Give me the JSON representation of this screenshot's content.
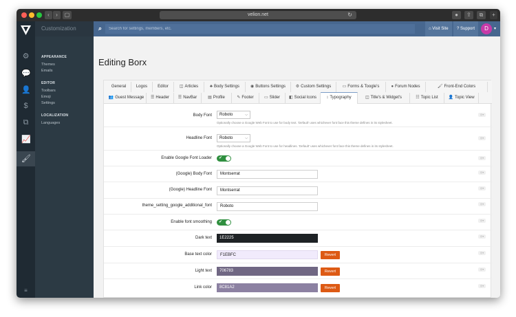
{
  "browser": {
    "url": "velion.net"
  },
  "sidebar": {
    "header": "Customization",
    "sections": [
      {
        "title": "APPEARANCE",
        "items": [
          "Themes",
          "Emails"
        ]
      },
      {
        "title": "EDITOR",
        "items": [
          "Toolbars",
          "Emoji",
          "Settings"
        ]
      },
      {
        "title": "LOCALIZATION",
        "items": [
          "Languages"
        ]
      }
    ],
    "rail_icons": [
      "logo-icon",
      "gears-icon",
      "chat-icon",
      "user-icon",
      "dollar-icon",
      "copy-icon",
      "chart-icon",
      "brush-icon"
    ]
  },
  "topbar": {
    "search_placeholder": "Search for settings, members, etc.",
    "visit_site": "Visit Site",
    "support": "Support",
    "avatar_letter": "D"
  },
  "page": {
    "title": "Editing Borx"
  },
  "tabs_row1": [
    "General",
    "Logos",
    "Editor",
    "Articles",
    "Body Settings",
    "Buttons Settings",
    "Custom Settings",
    "Forms & Toogle's",
    "Forum Nodes",
    "Front-End Colors"
  ],
  "tabs_row2": [
    "Guest Message",
    "Header",
    "NavBar",
    "Profile",
    "Footer",
    "Slider",
    "Social Icons",
    "Typography",
    "Title's & Widget's",
    "Topic List",
    "Topic View"
  ],
  "active_tab": "Typography",
  "settings": {
    "body_font": {
      "label": "Body Font",
      "value": "Roboto",
      "hint": "Optionally choose a Google Web Font to use for body text. 'Default' uses whichever font face this theme defines in its stylesheet."
    },
    "headline_font": {
      "label": "Headline Font",
      "value": "Roboto",
      "hint": "Optionally choose a Google Web Font to use for headlines. 'Default' uses whichever font face this theme defines in its stylesheet."
    },
    "google_loader": {
      "label": "Enable Google Font Loader"
    },
    "google_body": {
      "label": "(Google) Body Font",
      "value": "Montserrat"
    },
    "google_headline": {
      "label": "(Google) Headline Font",
      "value": "Montserrat"
    },
    "additional_font": {
      "label": "theme_setting_google_additional_font",
      "value": "Roboto"
    },
    "smoothing": {
      "label": "Enable font smoothing"
    },
    "dark_text": {
      "label": "Dark text",
      "value": "1E2225",
      "color": "#1e2225",
      "text_color": "#ffffff"
    },
    "base_text": {
      "label": "Base text color",
      "value": "F1EBFC",
      "color": "#f1ebfc",
      "text_color": "#222222",
      "revert": "Revert"
    },
    "light_text": {
      "label": "Light text",
      "value": "706783",
      "color": "#706783",
      "text_color": "#ffffff",
      "revert": "Revert"
    },
    "link_color": {
      "label": "Link color",
      "value": "8C81A2",
      "color": "#8c81a2",
      "text_color": "#ffffff",
      "revert": "Revert"
    }
  },
  "colors": {
    "topbar": "#47678f",
    "sidebar": "#2c3a44",
    "revert": "#dd5a14",
    "toggle": "#2f8f3f"
  }
}
